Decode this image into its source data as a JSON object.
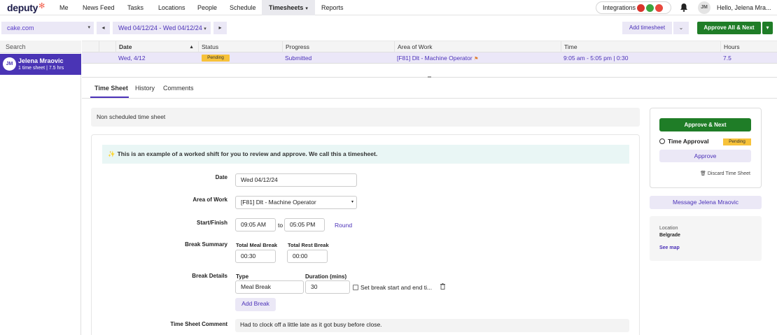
{
  "nav": {
    "logo": "deputy",
    "items": [
      "Me",
      "News Feed",
      "Tasks",
      "Locations",
      "People",
      "Schedule",
      "Timesheets",
      "Reports"
    ],
    "active": "Timesheets",
    "integrations_label": "Integrations",
    "avatar_initials": "JM",
    "greeting": "Hello, Jelena Mra..."
  },
  "toolbar": {
    "company": "cake.com",
    "prev": "◂",
    "date_range": "Wed 04/12/24 - Wed 04/12/24",
    "next": "▸",
    "add_timesheet": "Add timesheet",
    "approve_all": "Approve All & Next"
  },
  "left": {
    "search_placeholder": "Search",
    "employee": {
      "initials": "JM",
      "name": "Jelena Mraovic",
      "summary": "1 time sheet | 7.5 hrs"
    }
  },
  "grid": {
    "headers": [
      "Date",
      "Status",
      "Progress",
      "Area of Work",
      "Time",
      "Hours"
    ],
    "row": {
      "date": "Wed, 4/12",
      "status": "Pending",
      "progress": "Submitted",
      "area": "[F81] Dlt - Machine Operator",
      "time": "9:05 am - 5:05 pm | 0:30",
      "hours": "7.5"
    }
  },
  "tabs": [
    "Time Sheet",
    "History",
    "Comments"
  ],
  "detail": {
    "non_scheduled": "Non scheduled time sheet",
    "tip": "This is an example of a worked shift for you to review and approve. We call this a timesheet.",
    "date_label": "Date",
    "date_value": "Wed 04/12/24",
    "area_label": "Area of Work",
    "area_value": "[F81] Dlt - Machine Operator",
    "start_finish_label": "Start/Finish",
    "start": "09:05 AM",
    "to": "to",
    "finish": "05:05 PM",
    "round": "Round",
    "break_summary_label": "Break Summary",
    "total_meal_break_label": "Total Meal Break",
    "total_meal_break": "00:30",
    "total_rest_break_label": "Total Rest Break",
    "total_rest_break": "00:00",
    "break_details_label": "Break Details",
    "type_label": "Type",
    "duration_label": "Duration (mins)",
    "break_type": "Meal Break",
    "break_duration": "30",
    "set_break_label": "Set break start and end ti...",
    "add_break": "Add Break",
    "comment_label": "Time Sheet Comment",
    "comment": "Had to clock off a little late as it got busy before close."
  },
  "side": {
    "approve_next": "Approve & Next",
    "time_approval": "Time Approval",
    "status": "Pending",
    "approve": "Approve",
    "discard": "Discard Time Sheet",
    "message": "Message Jelena Mraovic",
    "location_label": "Location",
    "location": "Belgrade",
    "see_map": "See map"
  },
  "colors": {
    "accent": "#4b31b8",
    "approve_green": "#1f7d27",
    "pending_yellow": "#f7c23a"
  }
}
